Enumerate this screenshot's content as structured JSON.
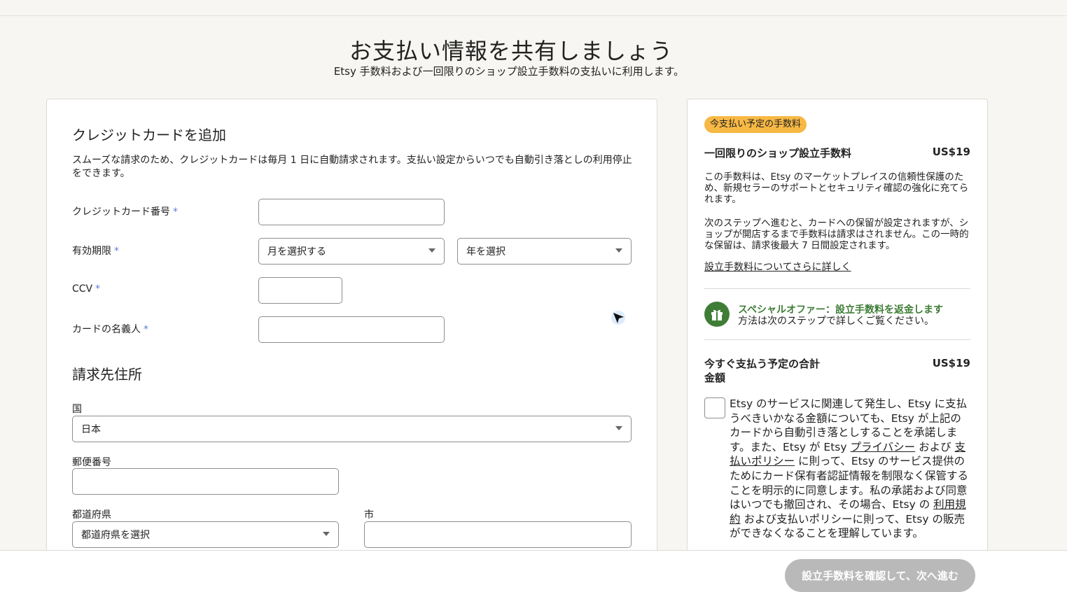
{
  "header": {
    "title": "お支払い情報を共有しましょう",
    "subtitle": "Etsy 手数料および一回限りのショップ設立手数料の支払いに利用します。"
  },
  "credit_card": {
    "heading": "クレジットカードを追加",
    "description": "スムーズな請求のため、クレジットカードは毎月 1 日に自動請求されます。支払い設定からいつでも自動引き落としの利用停止をできます。",
    "required_mark": "*",
    "card_number_label": "クレジットカード番号",
    "card_number_value": "",
    "expiry_label": "有効期限",
    "month_select": "月を選択する",
    "year_select": "年を選択",
    "ccv_label": "CCV",
    "ccv_value": "",
    "name_label": "カードの名義人",
    "name_value": ""
  },
  "billing": {
    "heading": "請求先住所",
    "country_label": "国",
    "country_value": "日本",
    "postal_label": "郵便番号",
    "postal_value": "",
    "prefecture_label": "都道府県",
    "prefecture_select": "都道府県を選択",
    "city_label": "市",
    "city_value": ""
  },
  "summary": {
    "badge": "今支払い予定の手数料",
    "fee_title": "一回限りのショップ設立手数料",
    "fee_amount": "US$19",
    "para1": "この手数料は、Etsy のマーケットプレイスの信頼性保護のため、新規セラーのサポートとセキュリティ確認の強化に充てられます。",
    "para2": "次のステップへ進むと、カードへの保留が設定されますが、ショップが開店するまで手数料は請求はされません。この一時的な保留は、請求後最大 7 日間設定されます。",
    "learn_more": "設立手数料についてさらに詳しく",
    "offer_title": "スペシャルオファー：設立手数料を返金します",
    "offer_sub": "方法は次のステップで詳しくご覧ください。",
    "total_title": "今すぐ支払う予定の合計金額",
    "total_amount": "US$19",
    "consent_1": "Etsy のサービスに関連して発生し、Etsy に支払うべきいかなる金額についても、Etsy が上記のカードから自動引き落としすることを承諾します。また、Etsy が Etsy ",
    "consent_privacy": "プライバシー",
    "consent_2": " および ",
    "consent_payment_policy": "支払いポリシー",
    "consent_3": " に則って、Etsy のサービス提供のためにカード保有者認証情報を制限なく保管することを明示的に同意します。私の承諾および同意はいつでも撤回され、その場合、Etsy の ",
    "consent_terms": "利用規約",
    "consent_4": " および支払いポリシーに則って、Etsy の販売ができなくなることを理解しています。"
  },
  "footer": {
    "primary_button": "設立手数料を確認して、次へ進む"
  },
  "colors": {
    "accent_badge": "#f7b844",
    "offer_green": "#3f7d37",
    "required_blue": "#5a7fd4",
    "disabled_button": "#b9b9b9"
  }
}
